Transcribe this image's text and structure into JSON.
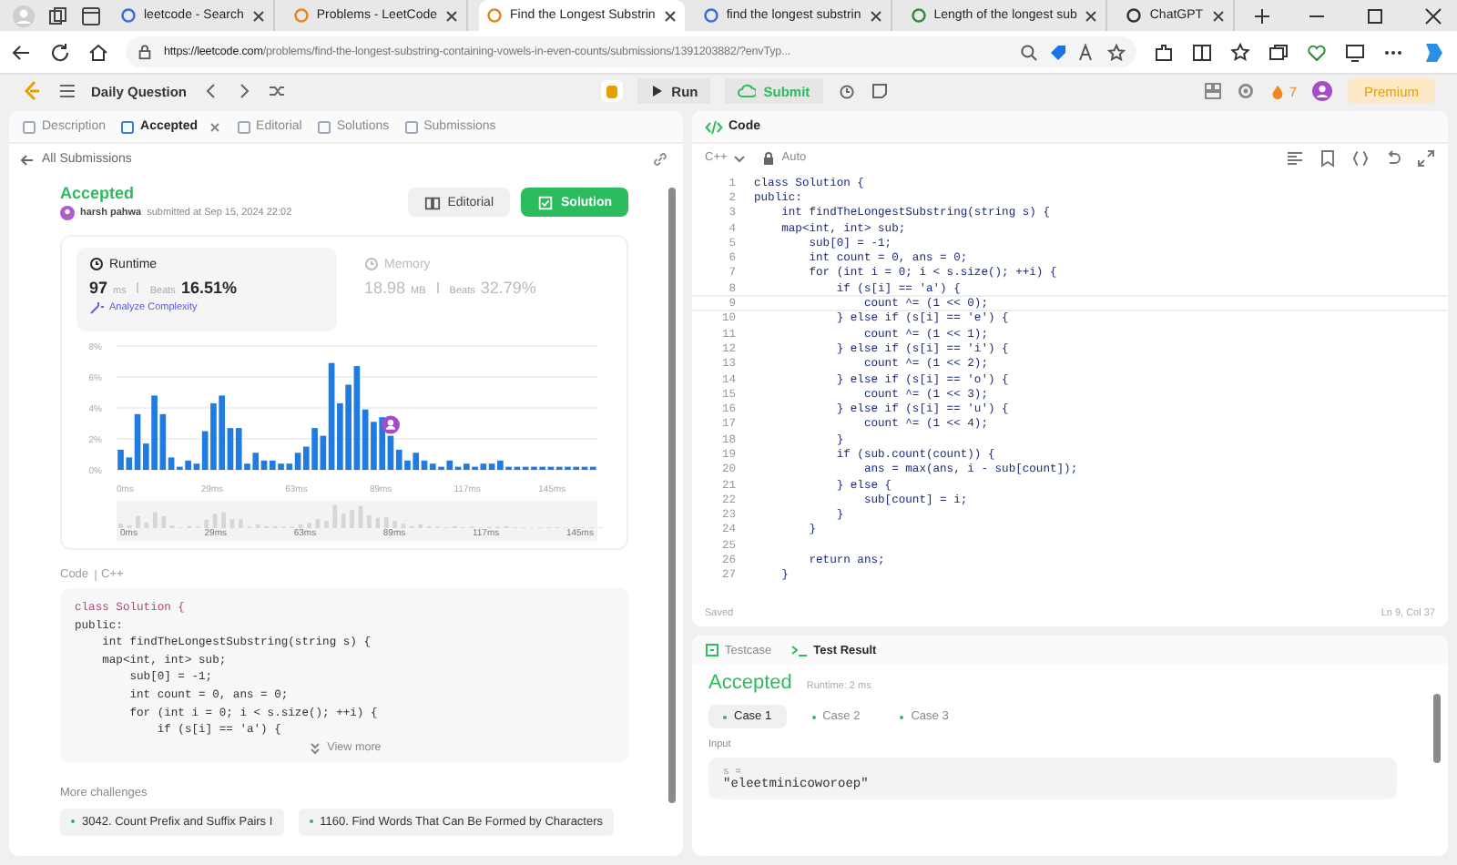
{
  "browser": {
    "tabs": [
      {
        "title": "leetcode - Search",
        "selected": false
      },
      {
        "title": "Problems - LeetCode",
        "selected": false
      },
      {
        "title": "Find the Longest Substrin",
        "selected": true
      },
      {
        "title": "find the longest substrin",
        "selected": false
      },
      {
        "title": "Length of the longest sub",
        "selected": false
      },
      {
        "title": "ChatGPT",
        "selected": false
      }
    ],
    "url": {
      "host": "https://leetcode.com",
      "path": "/problems/find-the-longest-substring-containing-vowels-in-even-counts/submissions/1391203882/?envTyp..."
    }
  },
  "topbar": {
    "daily": "Daily Question",
    "run": "Run",
    "submit": "Submit",
    "streak": "7",
    "premium": "Premium"
  },
  "left": {
    "tabs": [
      {
        "label": "Description",
        "selected": false,
        "closable": false
      },
      {
        "label": "Accepted",
        "selected": true,
        "closable": true
      },
      {
        "label": "Editorial",
        "selected": false,
        "closable": false
      },
      {
        "label": "Solutions",
        "selected": false,
        "closable": false
      },
      {
        "label": "Submissions",
        "selected": false,
        "closable": false
      }
    ],
    "back": "All Submissions",
    "status": "Accepted",
    "user": "harsh pahwa",
    "submitted": "submitted at Sep 15, 2024 22:02",
    "buttons": {
      "editorial": "Editorial",
      "solution": "Solution"
    },
    "stats": [
      {
        "label": "Runtime",
        "value": "97",
        "unit": "ms",
        "beats_label": "Beats",
        "beats": "16.51%",
        "selected": true,
        "link": "Analyze Complexity"
      },
      {
        "label": "Memory",
        "value": "18.98",
        "unit": "MB",
        "beats_label": "Beats",
        "beats": "32.79%",
        "selected": false
      }
    ],
    "chart_data": {
      "type": "bar",
      "values": [
        1.3,
        0.8,
        3.6,
        1.7,
        4.8,
        3.6,
        0.8,
        0.2,
        0.6,
        0.4,
        2.5,
        4.3,
        4.8,
        2.7,
        2.7,
        0.4,
        1.1,
        0.6,
        0.6,
        0.4,
        0.4,
        1.1,
        1.5,
        2.7,
        2.2,
        6.9,
        4.3,
        5.5,
        6.7,
        3.9,
        3.1,
        3.4,
        2.2,
        1.3,
        0.6,
        1.1,
        0.6,
        0.4,
        0.2,
        0.6,
        0.2,
        0.4,
        0.2,
        0.4,
        0.4,
        0.6,
        0.2,
        0.2,
        0.2,
        0.2,
        0.2,
        0.2,
        0.2,
        0.2,
        0.2,
        0.2,
        0.2
      ],
      "grid": true,
      "yticks": [
        {
          "value": 0,
          "label": "0%"
        },
        {
          "value": 2,
          "label": "2%"
        },
        {
          "value": 4,
          "label": "4%"
        },
        {
          "value": 6,
          "label": "6%"
        },
        {
          "value": 8,
          "label": "8%"
        }
      ],
      "ylim": [
        0,
        8
      ]
    },
    "axis_labels": [
      "0ms",
      "29ms",
      "63ms",
      "89ms",
      "117ms",
      "145ms"
    ],
    "submission_marker": {
      "level": 0.57
    },
    "overview_labels": [
      "0ms",
      "29ms",
      "63ms",
      "89ms",
      "117ms",
      "145ms"
    ],
    "code_label": "Code",
    "code_lang": "C++",
    "code": [
      "class Solution {",
      "public:",
      "    int findTheLongestSubstring(string s) {",
      "    map<int, int> sub;",
      "        sub[0] = -1;",
      "        int count = 0, ans = 0;",
      "        for (int i = 0; i < s.size(); ++i) {",
      "            if (s[i] == 'a') {"
    ],
    "view_more": "View more",
    "more": "More challenges",
    "challenges": [
      "3042. Count Prefix and Suffix Pairs I",
      "1160. Find Words That Can Be Formed by Characters"
    ]
  },
  "editor": {
    "title": "Code",
    "language": "C++",
    "mode": "Auto",
    "lines": [
      {
        "n": "1",
        "text": "class Solution {",
        "current": false
      },
      {
        "n": "2",
        "text": "public:",
        "current": false
      },
      {
        "n": "3",
        "text": "    int findTheLongestSubstring(string s) {",
        "current": false
      },
      {
        "n": "4",
        "text": "    map<int, int> sub;",
        "current": false
      },
      {
        "n": "5",
        "text": "        sub[0] = -1;",
        "current": false
      },
      {
        "n": "6",
        "text": "        int count = 0, ans = 0;",
        "current": false
      },
      {
        "n": "7",
        "text": "        for (int i = 0; i < s.size(); ++i) {",
        "current": false
      },
      {
        "n": "8",
        "text": "            if (s[i] == 'a') {",
        "current": false
      },
      {
        "n": "9",
        "text": "                count ^= (1 << 0);",
        "current": true
      },
      {
        "n": "10",
        "text": "            } else if (s[i] == 'e') {",
        "current": false
      },
      {
        "n": "11",
        "text": "                count ^= (1 << 1);",
        "current": false
      },
      {
        "n": "12",
        "text": "            } else if (s[i] == 'i') {",
        "current": false
      },
      {
        "n": "13",
        "text": "                count ^= (1 << 2);",
        "current": false
      },
      {
        "n": "14",
        "text": "            } else if (s[i] == 'o') {",
        "current": false
      },
      {
        "n": "15",
        "text": "                count ^= (1 << 3);",
        "current": false
      },
      {
        "n": "16",
        "text": "            } else if (s[i] == 'u') {",
        "current": false
      },
      {
        "n": "17",
        "text": "                count ^= (1 << 4);",
        "current": false
      },
      {
        "n": "18",
        "text": "            }",
        "current": false
      },
      {
        "n": "19",
        "text": "            if (sub.count(count)) {",
        "current": false
      },
      {
        "n": "20",
        "text": "                ans = max(ans, i - sub[count]);",
        "current": false
      },
      {
        "n": "21",
        "text": "            } else {",
        "current": false
      },
      {
        "n": "22",
        "text": "                sub[count] = i;",
        "current": false
      },
      {
        "n": "23",
        "text": "            }",
        "current": false
      },
      {
        "n": "24",
        "text": "        }",
        "current": false
      },
      {
        "n": "25",
        "current": false
      },
      {
        "n": "26",
        "text": "        return ans;",
        "current": false
      },
      {
        "n": "27",
        "text": "    }",
        "current": false
      }
    ],
    "saved": "Saved",
    "cursor": "Ln 9, Col 37"
  },
  "result": {
    "tabs": [
      {
        "label": "Testcase",
        "selected": false,
        "kind": "testcase"
      },
      {
        "label": "Test Result",
        "selected": true,
        "kind": "result"
      }
    ],
    "status": "Accepted",
    "runtime": "Runtime: 2 ms",
    "cases": [
      {
        "label": "Case 1",
        "selected": true
      },
      {
        "label": "Case 2",
        "selected": false
      },
      {
        "label": "Case 3",
        "selected": false
      }
    ],
    "input_label": "Input",
    "var": "s =",
    "value": "\"eleetminicoworoep\""
  }
}
